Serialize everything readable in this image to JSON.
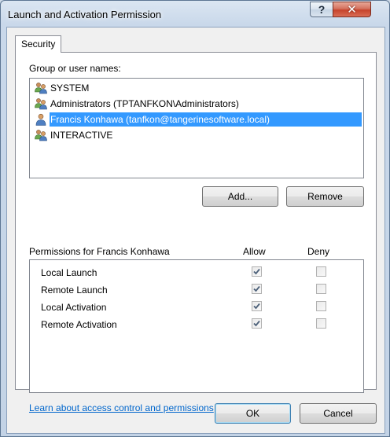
{
  "window": {
    "title": "Launch and Activation Permission",
    "help_glyph": "?",
    "close_glyph": "✕"
  },
  "tabs": [
    {
      "label": "Security",
      "selected": true
    }
  ],
  "groups": {
    "label": "Group or user names:",
    "items": [
      {
        "name": "SYSTEM",
        "icon": "group-users-icon",
        "selected": false
      },
      {
        "name": "Administrators (TPTANFKON\\Administrators)",
        "icon": "group-users-icon",
        "selected": false
      },
      {
        "name": "Francis Konhawa (tanfkon@tangerinesoftware.local)",
        "icon": "single-user-icon",
        "selected": true
      },
      {
        "name": "INTERACTIVE",
        "icon": "group-users-icon",
        "selected": false
      }
    ]
  },
  "buttons": {
    "add": "Add...",
    "remove": "Remove",
    "ok": "OK",
    "cancel": "Cancel"
  },
  "permissions": {
    "header": "Permissions for Francis Konhawa",
    "allow_label": "Allow",
    "deny_label": "Deny",
    "rows": [
      {
        "name": "Local Launch",
        "allow": true,
        "deny": false
      },
      {
        "name": "Remote Launch",
        "allow": true,
        "deny": false
      },
      {
        "name": "Local Activation",
        "allow": true,
        "deny": false
      },
      {
        "name": "Remote Activation",
        "allow": true,
        "deny": false
      }
    ]
  },
  "link_text": "Learn about access control and permissions",
  "colors": {
    "selection": "#3399ff",
    "link": "#0066cc",
    "close_button": "#c7432c"
  }
}
